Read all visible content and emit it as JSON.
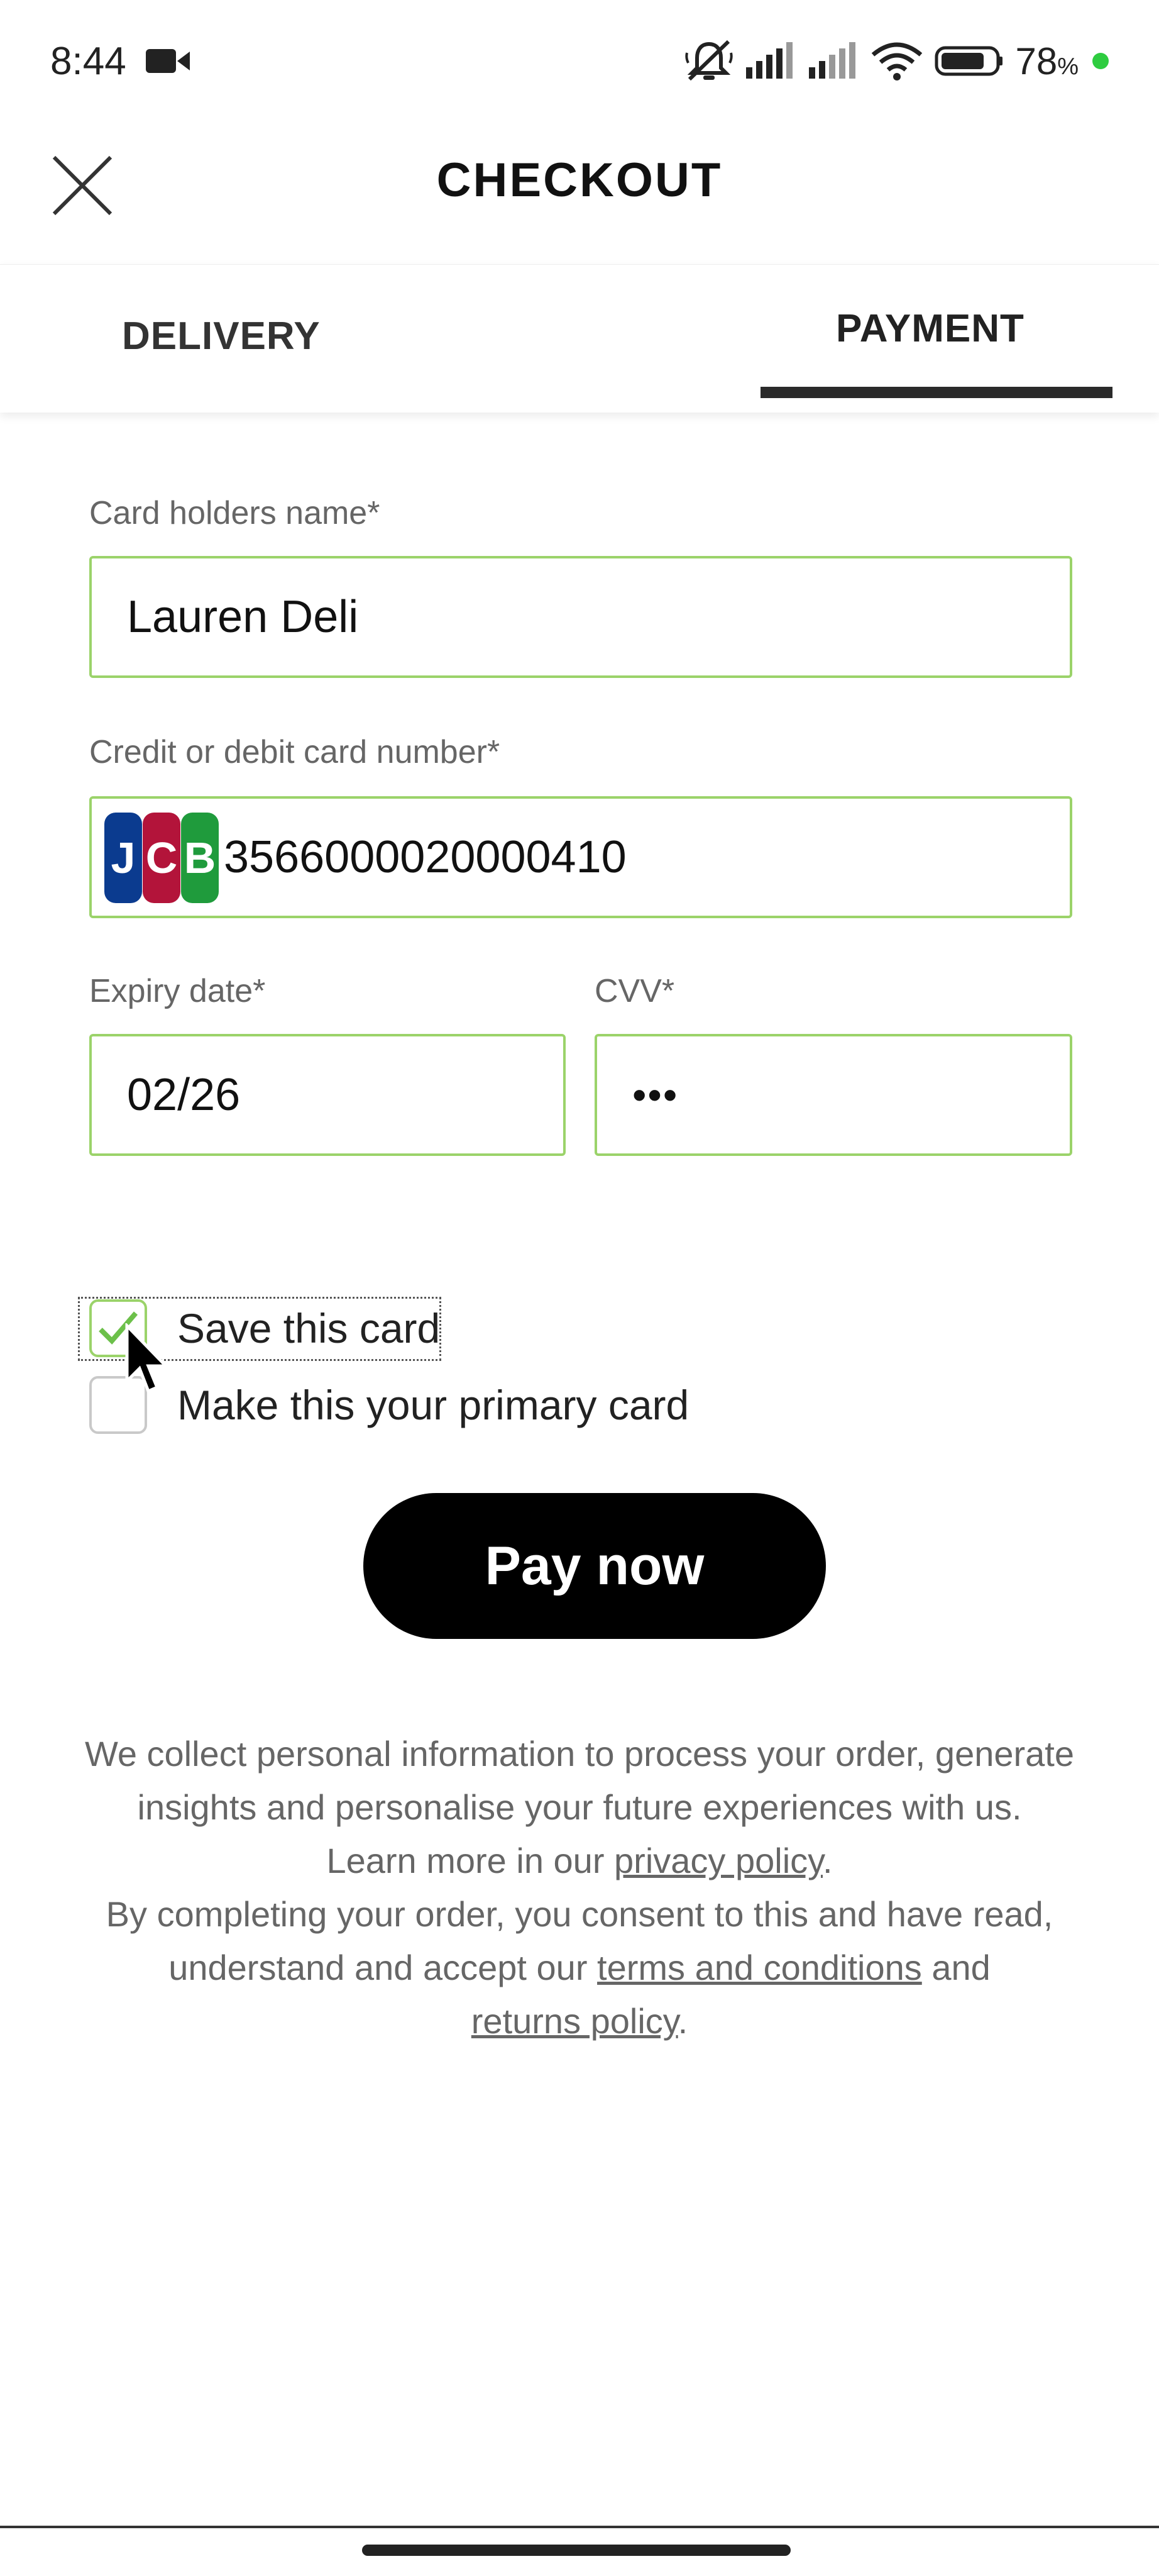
{
  "status_bar": {
    "time": "8:44",
    "icons": [
      "video-camera-icon",
      "mute-bell-icon",
      "signal-icon",
      "signal-icon",
      "wifi-icon",
      "battery-icon"
    ],
    "battery_percent": "78",
    "battery_suffix": "%",
    "battery_level": 0.78
  },
  "header": {
    "title": "CHECKOUT",
    "close_icon": "close-icon"
  },
  "tabs": {
    "delivery_label": "DELIVERY",
    "payment_label": "PAYMENT",
    "active": "PAYMENT"
  },
  "form": {
    "cardholder_label": "Card holders name*",
    "cardholder_value": "Lauren Deli",
    "card_number_label": "Credit or debit card number*",
    "card_number_value": "3566000020000410",
    "card_brand": "JCB",
    "expiry_label": "Expiry date*",
    "expiry_value": "02/26",
    "cvv_label": "CVV*",
    "cvv_value": "•••"
  },
  "options": {
    "save_card_label": "Save this card",
    "save_card_checked": true,
    "primary_card_label": "Make this your primary card",
    "primary_card_checked": false
  },
  "pay_button_label": "Pay now",
  "legal": {
    "line1": "We collect personal information to process your order, generate insights and personalise your future experiences with us.",
    "line2_prefix": "Learn more in our ",
    "privacy_link": "privacy policy",
    "period1": ".",
    "line3_prefix": "By completing your order, you consent to this and have read, understand and accept our ",
    "terms_link": "terms and conditions",
    "and_text": " and ",
    "returns_link": "returns policy",
    "period2": "."
  },
  "colors": {
    "field_border": "#9bd36a",
    "checkbox_green": "#6cc04a",
    "primary_button": "#000000",
    "charge_dot": "#2ecc40"
  }
}
